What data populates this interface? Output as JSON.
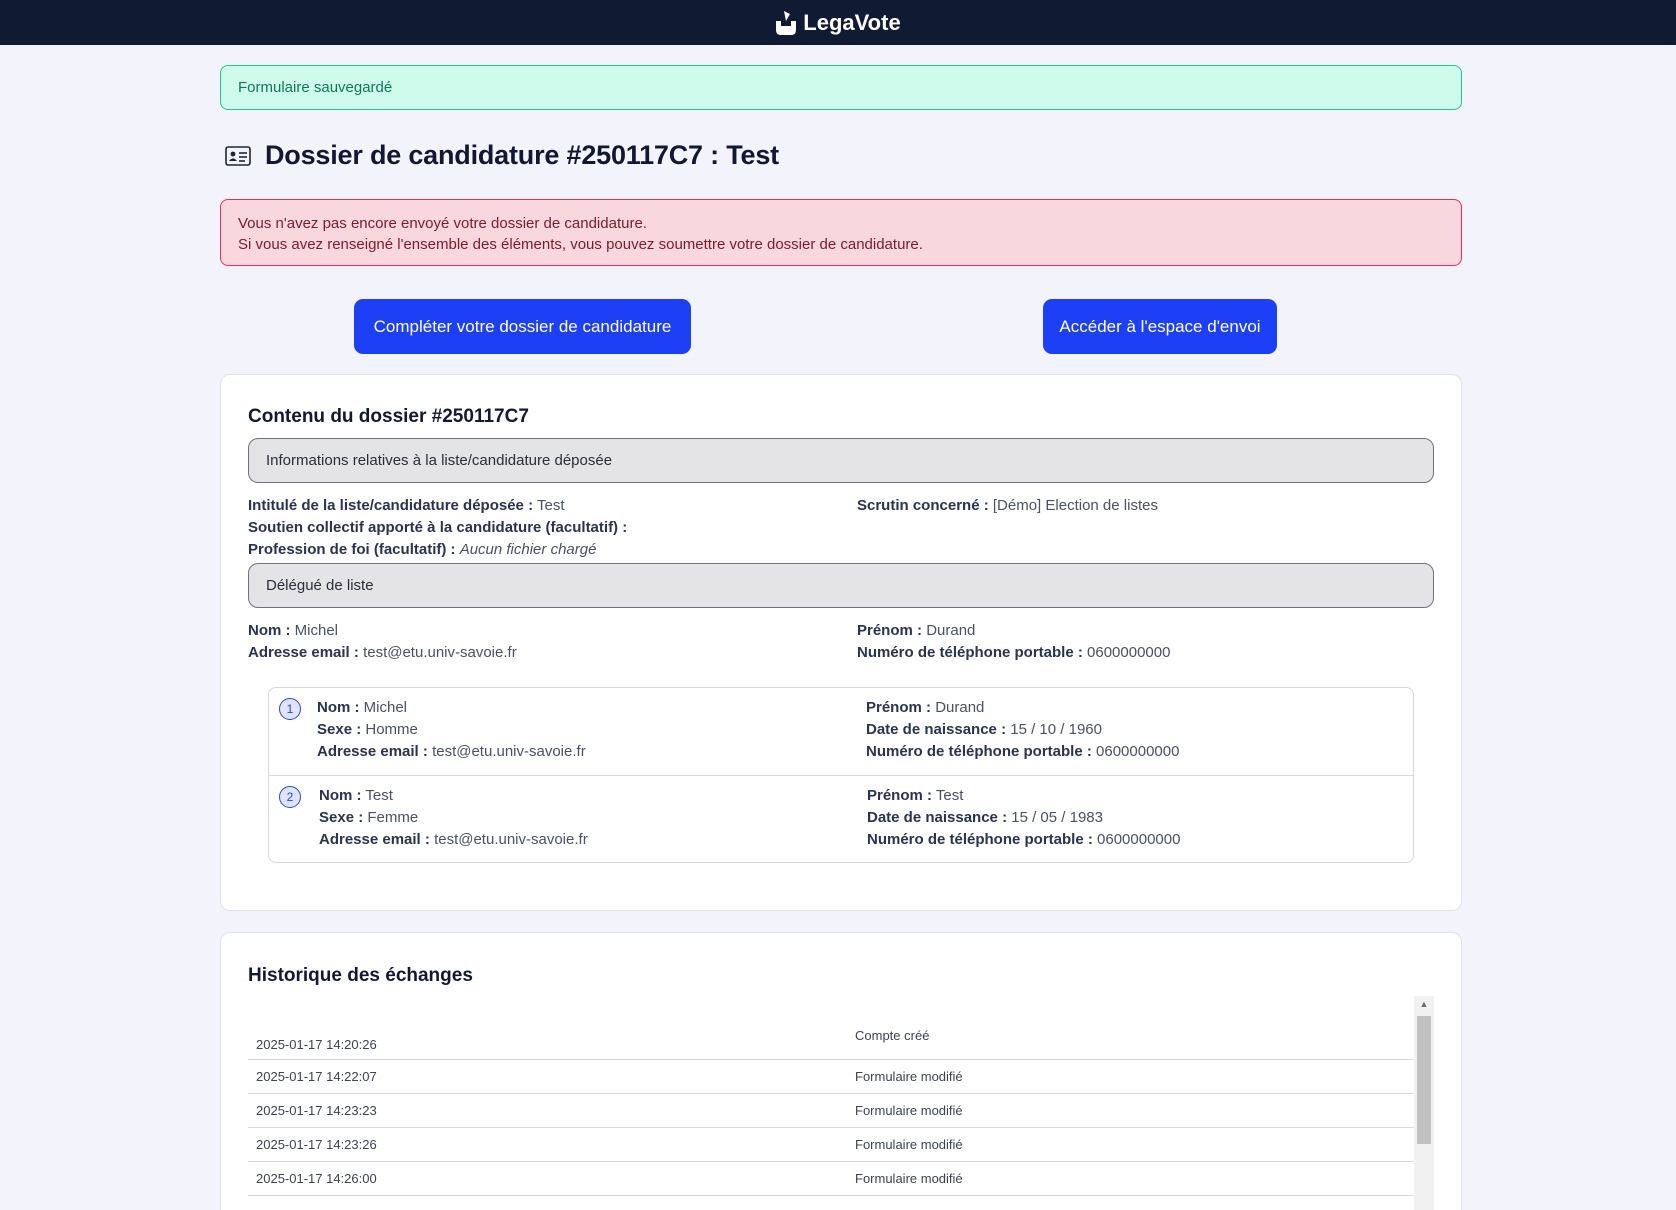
{
  "header": {
    "brand": "LegaVote"
  },
  "alerts": {
    "success": "Formulaire sauvegardé",
    "warning_line1": "Vous n'avez pas encore envoyé votre dossier de candidature.",
    "warning_line2": "Si vous avez renseigné l'ensemble des éléments, vous pouvez soumettre votre dossier de candidature."
  },
  "page": {
    "title": "Dossier de candidature #250117C7 : Test"
  },
  "actions": {
    "complete_label": "Compléter votre dossier de candidature",
    "send_label": "Accéder à l'espace d'envoi"
  },
  "dossier": {
    "title": "Contenu du dossier #250117C7",
    "section_list": "Informations relatives à la liste/candidature déposée",
    "list_title_label": "Intitulé de la liste/candidature déposée :",
    "list_title_value": "Test",
    "scrutin_label": "Scrutin concerné :",
    "scrutin_value": "[Démo] Election de listes",
    "soutien_label": "Soutien collectif apporté à la candidature (facultatif) :",
    "profession_label": "Profession de foi (facultatif) :",
    "profession_value": "Aucun fichier chargé",
    "section_delegate": "Délégué de liste",
    "delegate": {
      "nom_label": "Nom :",
      "nom": "Michel",
      "prenom_label": "Prénom :",
      "prenom": "Durand",
      "email_label": "Adresse email :",
      "email": "test@etu.univ-savoie.fr",
      "phone_label": "Numéro de téléphone portable :",
      "phone": "0600000000"
    },
    "members": [
      {
        "number": "1",
        "nom_label": "Nom :",
        "nom": "Michel",
        "sexe_label": "Sexe :",
        "sexe": "Homme",
        "email_label": "Adresse email :",
        "email": "test@etu.univ-savoie.fr",
        "prenom_label": "Prénom :",
        "prenom": "Durand",
        "birth_label": "Date de naissance :",
        "birth": "15 / 10 / 1960",
        "phone_label": "Numéro de téléphone portable :",
        "phone": "0600000000"
      },
      {
        "number": "2",
        "nom_label": "Nom :",
        "nom": "Test",
        "sexe_label": "Sexe :",
        "sexe": "Femme",
        "email_label": "Adresse email :",
        "email": "test@etu.univ-savoie.fr",
        "prenom_label": "Prénom :",
        "prenom": "Test",
        "birth_label": "Date de naissance :",
        "birth": "15 / 05 / 1983",
        "phone_label": "Numéro de téléphone portable :",
        "phone": "0600000000"
      }
    ]
  },
  "history": {
    "title": "Historique des échanges",
    "rows": [
      {
        "date": "2025-01-17 14:20:26",
        "event": "Compte créé"
      },
      {
        "date": "2025-01-17 14:22:07",
        "event": "Formulaire modifié"
      },
      {
        "date": "2025-01-17 14:23:23",
        "event": "Formulaire modifié"
      },
      {
        "date": "2025-01-17 14:23:26",
        "event": "Formulaire modifié"
      },
      {
        "date": "2025-01-17 14:26:00",
        "event": "Formulaire modifié"
      }
    ]
  }
}
